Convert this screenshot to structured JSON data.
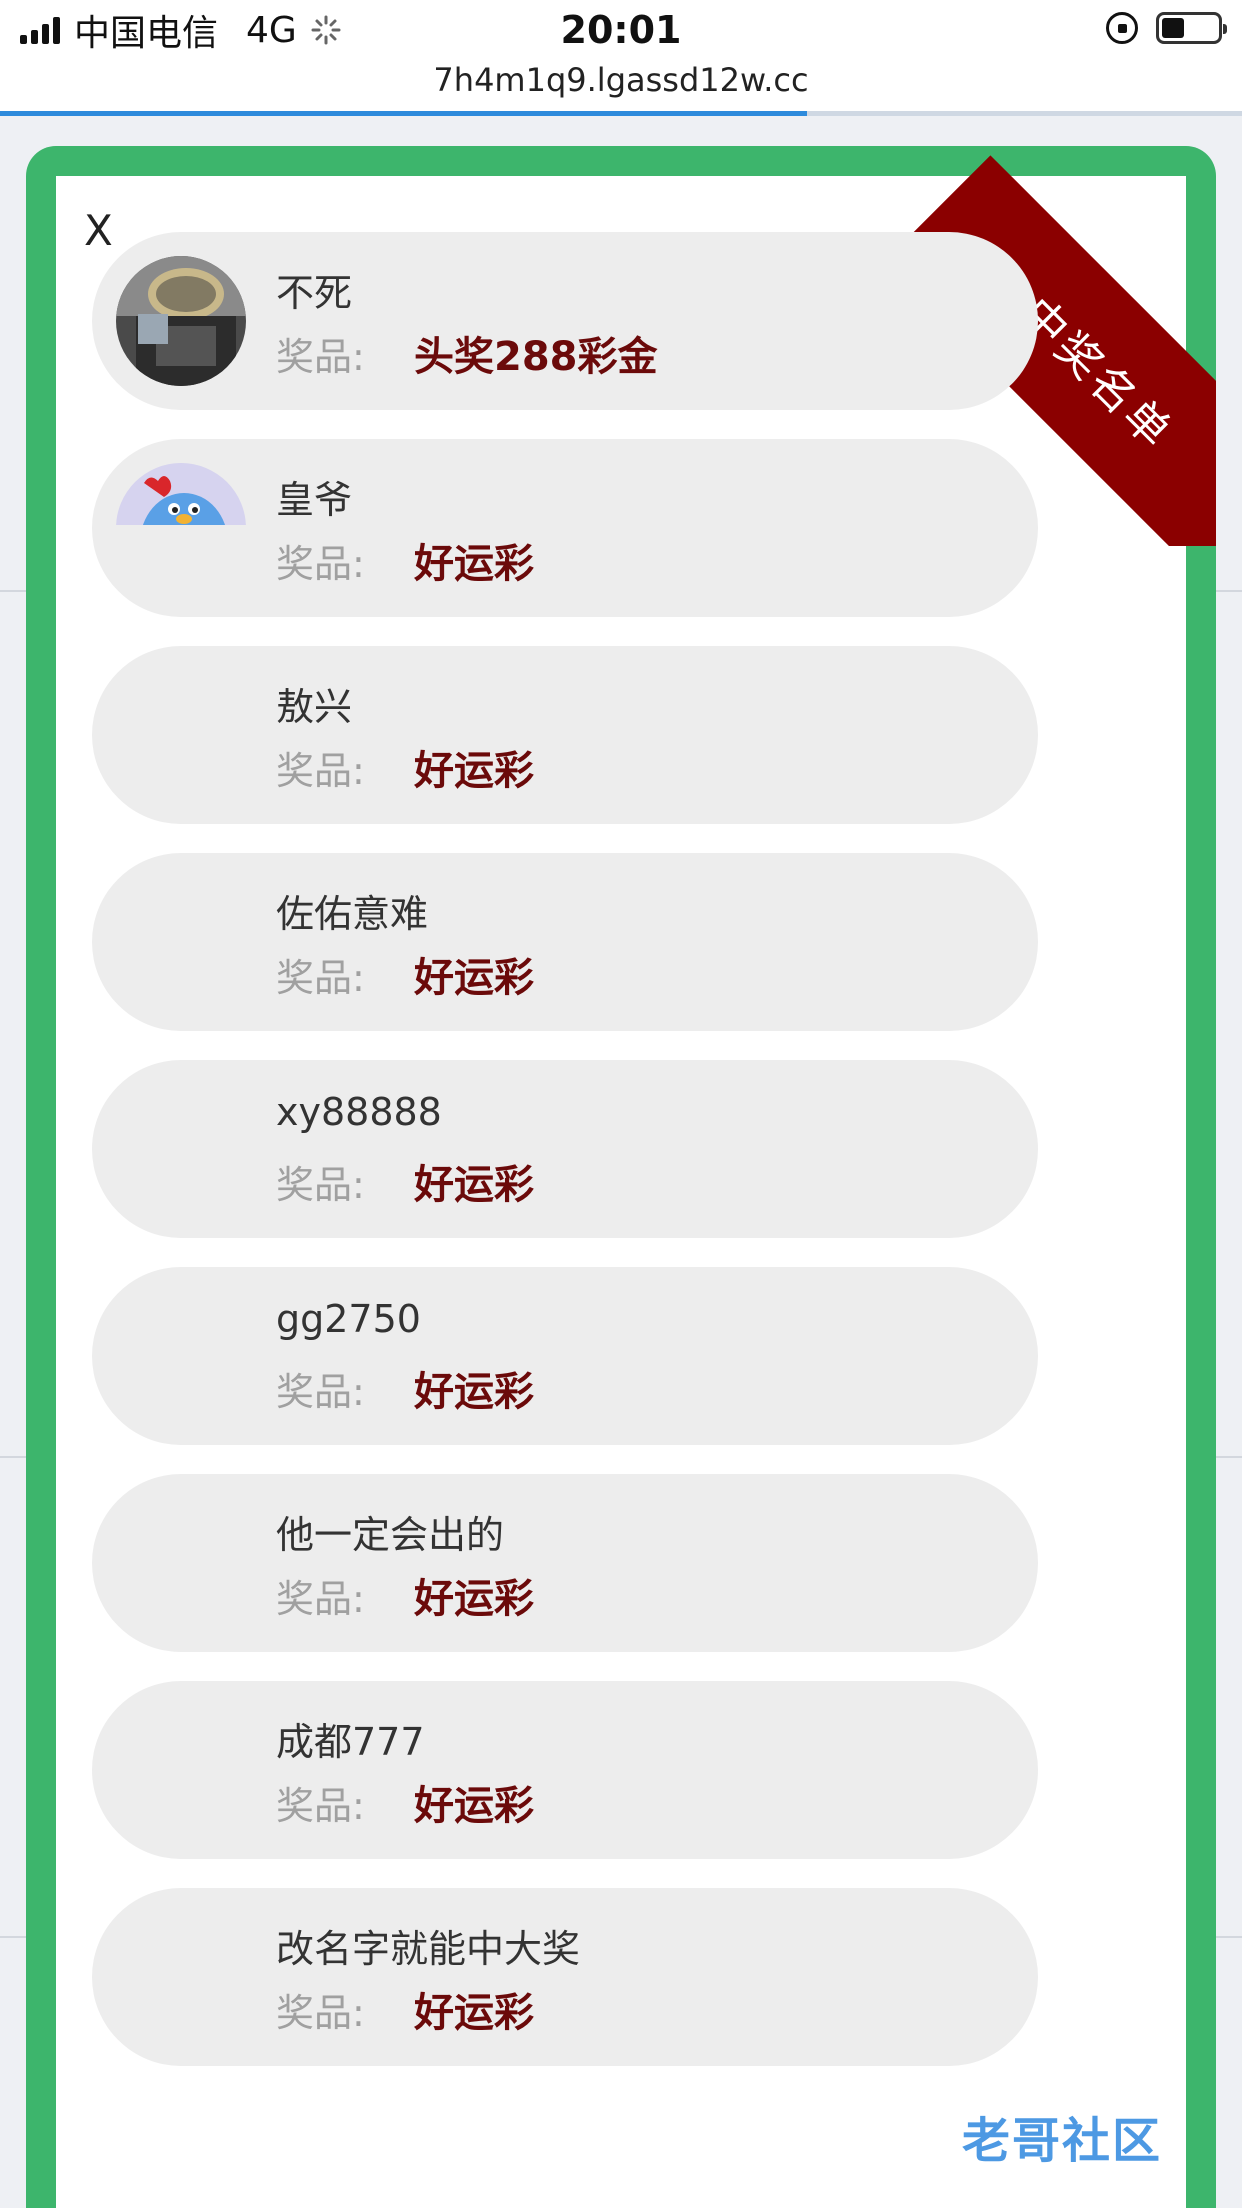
{
  "status_bar": {
    "carrier": "中国电信",
    "network": "4G",
    "time": "20:01",
    "battery_level": 0.4
  },
  "browser": {
    "url": "7h4m1q9.lgassd12w.cc",
    "load_progress": 0.65
  },
  "modal": {
    "close_label": "X",
    "ribbon_label": "中奖名单",
    "prize_label": "奖品:",
    "winners": [
      {
        "name": "不死",
        "prize": "头奖288彩金",
        "avatar": "photo"
      },
      {
        "name": "皇爷",
        "prize": "好运彩",
        "avatar": "chick"
      },
      {
        "name": "敖兴",
        "prize": "好运彩",
        "avatar": "none"
      },
      {
        "name": "佐佑意难",
        "prize": "好运彩",
        "avatar": "none"
      },
      {
        "name": "xy88888",
        "prize": "好运彩",
        "avatar": "none"
      },
      {
        "name": "gg2750",
        "prize": "好运彩",
        "avatar": "none"
      },
      {
        "name": "他一定会出的",
        "prize": "好运彩",
        "avatar": "none"
      },
      {
        "name": "成都777",
        "prize": "好运彩",
        "avatar": "none"
      },
      {
        "name": "改名字就能中大奖",
        "prize": "好运彩",
        "avatar": "none"
      }
    ]
  },
  "watermark": {
    "text": "老哥社区"
  },
  "colors": {
    "frame": "#3db56c",
    "ribbon": "#8b0000",
    "prize": "#6b0a0a",
    "item_bg": "#ededed"
  }
}
